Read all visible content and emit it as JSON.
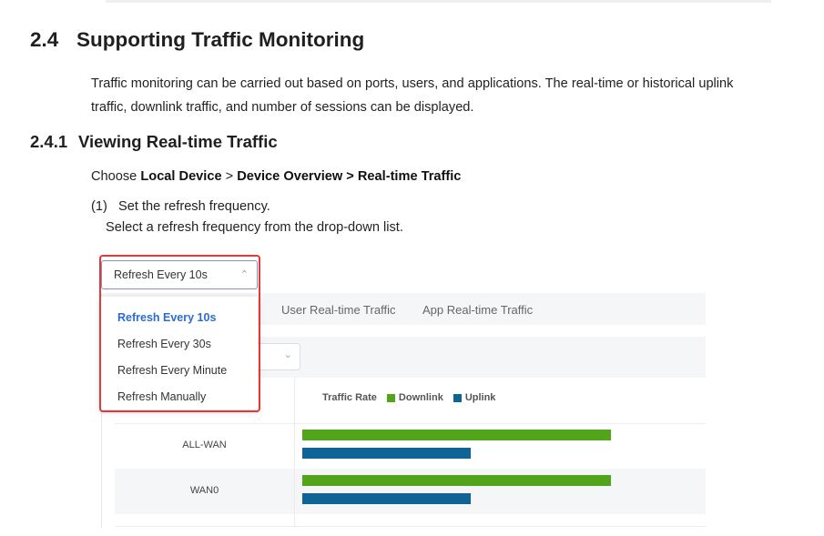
{
  "section": {
    "number": "2.4",
    "title": "Supporting Traffic Monitoring",
    "paragraph": "Traffic monitoring can be carried out based on ports, users, and applications. The real-time or historical uplink traffic, downlink traffic, and number of sessions can be displayed."
  },
  "subsection": {
    "number": "2.4.1",
    "title": "Viewing Real-time Traffic",
    "choose_prefix": "Choose ",
    "path_part1": "Local Device",
    "path_sep": " > ",
    "path_part2": "Device Overview > Real-time Traffic",
    "step_number": "(1)",
    "step_text": "Set the refresh frequency.",
    "step_detail": "Select a refresh frequency from the drop-down list."
  },
  "screenshot": {
    "tabs": [
      "User Real-time Traffic",
      "App Real-time Traffic"
    ],
    "legend": {
      "title": "Traffic Rate",
      "downlink": "Downlink",
      "uplink": "Uplink"
    },
    "rows": [
      {
        "label": "ALL-WAN",
        "downlink": 1.0,
        "uplink": 0.546
      },
      {
        "label": "WAN0",
        "downlink": 1.0,
        "uplink": 0.546
      }
    ],
    "dropdown": {
      "selected": "Refresh Every 10s",
      "options": [
        "Refresh Every 10s",
        "Refresh Every 30s",
        "Refresh Every Minute",
        "Refresh Manually"
      ]
    },
    "colors": {
      "downlink": "#52a41a",
      "uplink": "#0f6496",
      "highlight": "#e53935",
      "active_option": "#2c6bd6"
    }
  }
}
